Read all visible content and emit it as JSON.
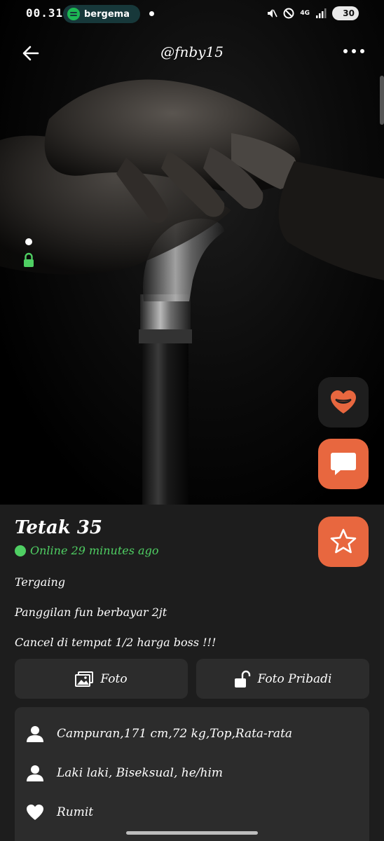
{
  "status_bar": {
    "time": "00.31",
    "media_app_label": "bergema",
    "network": "4G",
    "battery": "30"
  },
  "header": {
    "handle": "@fnby15"
  },
  "profile": {
    "name": "Tetak 35",
    "online_status": "Online 29 minutes ago",
    "about_lines": [
      "Tergaing",
      "Panggilan fun berbayar 2jt",
      "Cancel di tempat 1/2 harga boss !!!"
    ]
  },
  "tabs": {
    "photos_label": "Foto",
    "private_photos_label": "Foto Pribadi"
  },
  "details": {
    "stats": "Campuran,171 cm,72 kg,Top,Rata-rata",
    "identity": "Laki laki, Biseksual, he/him",
    "relationship": "Rumit"
  },
  "colors": {
    "accent": "#e8673f",
    "online": "#4fcf63",
    "panel": "#1d1d1d",
    "card": "#2c2c2c"
  },
  "icons": {
    "back": "arrow-left-icon",
    "more": "more-dots-icon",
    "lock": "lock-icon",
    "taps": "heart-lips-icon",
    "chat": "chat-bubble-icon",
    "favorite": "star-icon",
    "photos": "image-icon",
    "private": "unlock-icon",
    "person": "person-icon",
    "heart": "heart-icon"
  }
}
